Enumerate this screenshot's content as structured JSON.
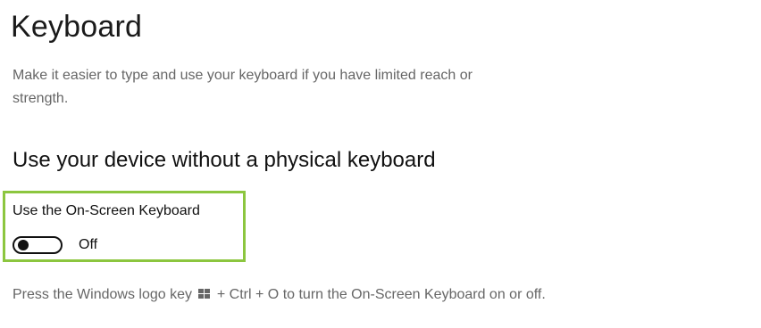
{
  "page": {
    "title": "Keyboard",
    "description": "Make it easier to type and use your keyboard if you have limited reach or strength."
  },
  "section": {
    "heading": "Use your device without a physical keyboard"
  },
  "on_screen_keyboard": {
    "label": "Use the On-Screen Keyboard",
    "state_label": "Off",
    "enabled": false,
    "highlight_color": "#8cc63f"
  },
  "hint": {
    "before_icon": "Press the Windows logo key",
    "icon": "windows-logo-icon",
    "after_icon": "+ Ctrl + O to turn the On-Screen Keyboard on or off."
  }
}
